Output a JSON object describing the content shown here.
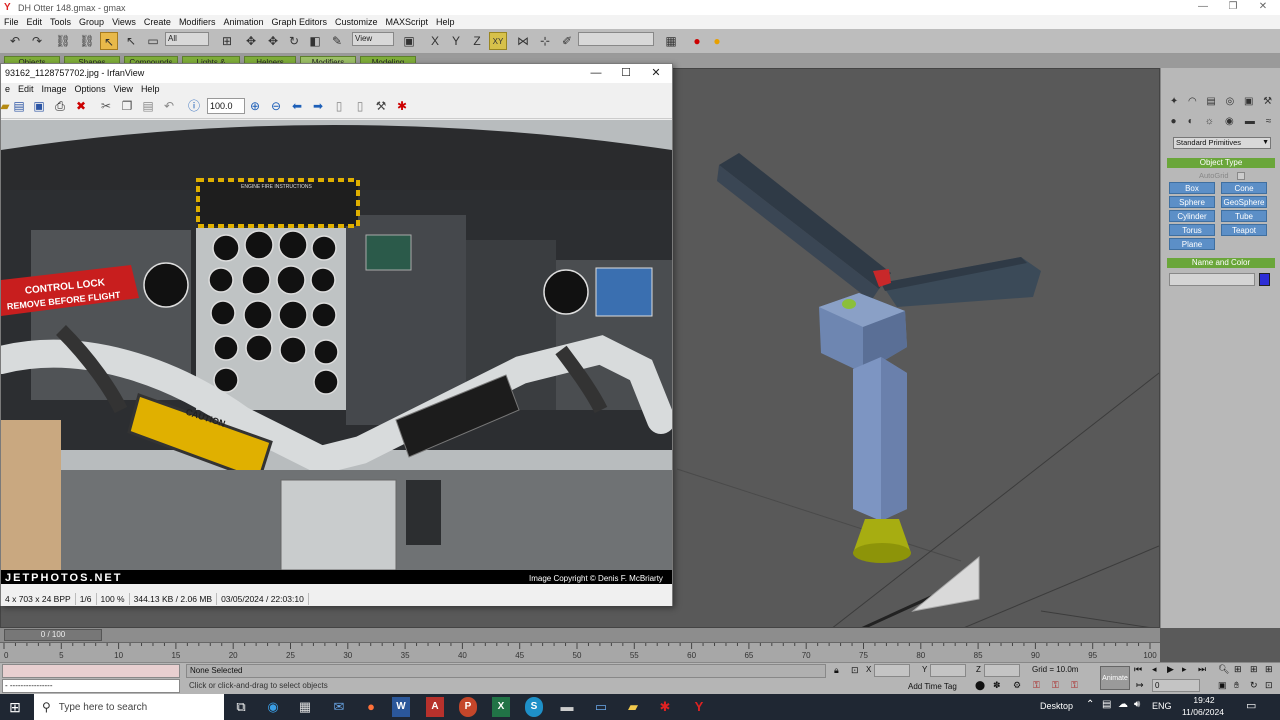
{
  "gmax": {
    "title": "DH Otter 148.gmax - gmax",
    "menu": [
      "File",
      "Edit",
      "Tools",
      "Group",
      "Views",
      "Create",
      "Modifiers",
      "Animation",
      "Graph Editors",
      "Customize",
      "MAXScript",
      "Help"
    ],
    "toolbar": {
      "selection_filter": "All",
      "coord_system": "View",
      "axis_label": "XY"
    },
    "tabs": [
      "Objects",
      "Shapes",
      "Compounds",
      "Lights & Cameras",
      "Helpers",
      "Modifiers",
      "Modeling"
    ],
    "active_tab_index": 5
  },
  "command_panel": {
    "dropdown": "Standard Primitives",
    "object_type_header": "Object Type",
    "autogrid_label": "AutoGrid",
    "buttons": [
      "Box",
      "Cone",
      "Sphere",
      "GeoSphere",
      "Cylinder",
      "Tube",
      "Torus",
      "Teapot",
      "Plane"
    ],
    "name_color_header": "Name and Color",
    "name_value": "",
    "color_swatch": "#2d2dd6"
  },
  "irfanview": {
    "title": "93162_1128757702.jpg - IrfanView",
    "menu": [
      "e",
      "Edit",
      "Image",
      "Options",
      "View",
      "Help"
    ],
    "zoom": "100.0",
    "photo": {
      "label_control_lock": "CONTROL LOCK",
      "label_remove": "REMOVE BEFORE FLIGHT",
      "label_caution": "CAUTION",
      "watermark_left": "JETPHOTOS.NET",
      "watermark_right": "Image Copyright © Denis F. McBriarty",
      "panel_title": "ENGINE FIRE INSTRUCTIONS"
    },
    "status": [
      "4 x 703 x 24 BPP",
      "1/6",
      "100 %",
      "344.13 KB / 2.06 MB",
      "03/05/2024 / 22:03:10"
    ]
  },
  "time": {
    "slider_label": "0 / 100",
    "ticks": [
      "0",
      "5",
      "10",
      "15",
      "20",
      "25",
      "30",
      "35",
      "40",
      "45",
      "50",
      "55",
      "60",
      "65",
      "70",
      "75",
      "80",
      "85",
      "90",
      "95",
      "100"
    ]
  },
  "status_bar": {
    "selection": "None Selected",
    "prompt": "Click or click-and-drag to select objects",
    "listener": "- ----------------",
    "x_label": "X",
    "y_label": "Y",
    "z_label": "Z",
    "grid": "Grid = 10.0m",
    "add_time_tag": "Add Time Tag",
    "animate": "Animate",
    "frame": "0"
  },
  "taskbar": {
    "search_placeholder": "Type here to search",
    "desktop": "Desktop",
    "lang": "ENG",
    "time": "19:42",
    "date": "11/06/2024"
  }
}
